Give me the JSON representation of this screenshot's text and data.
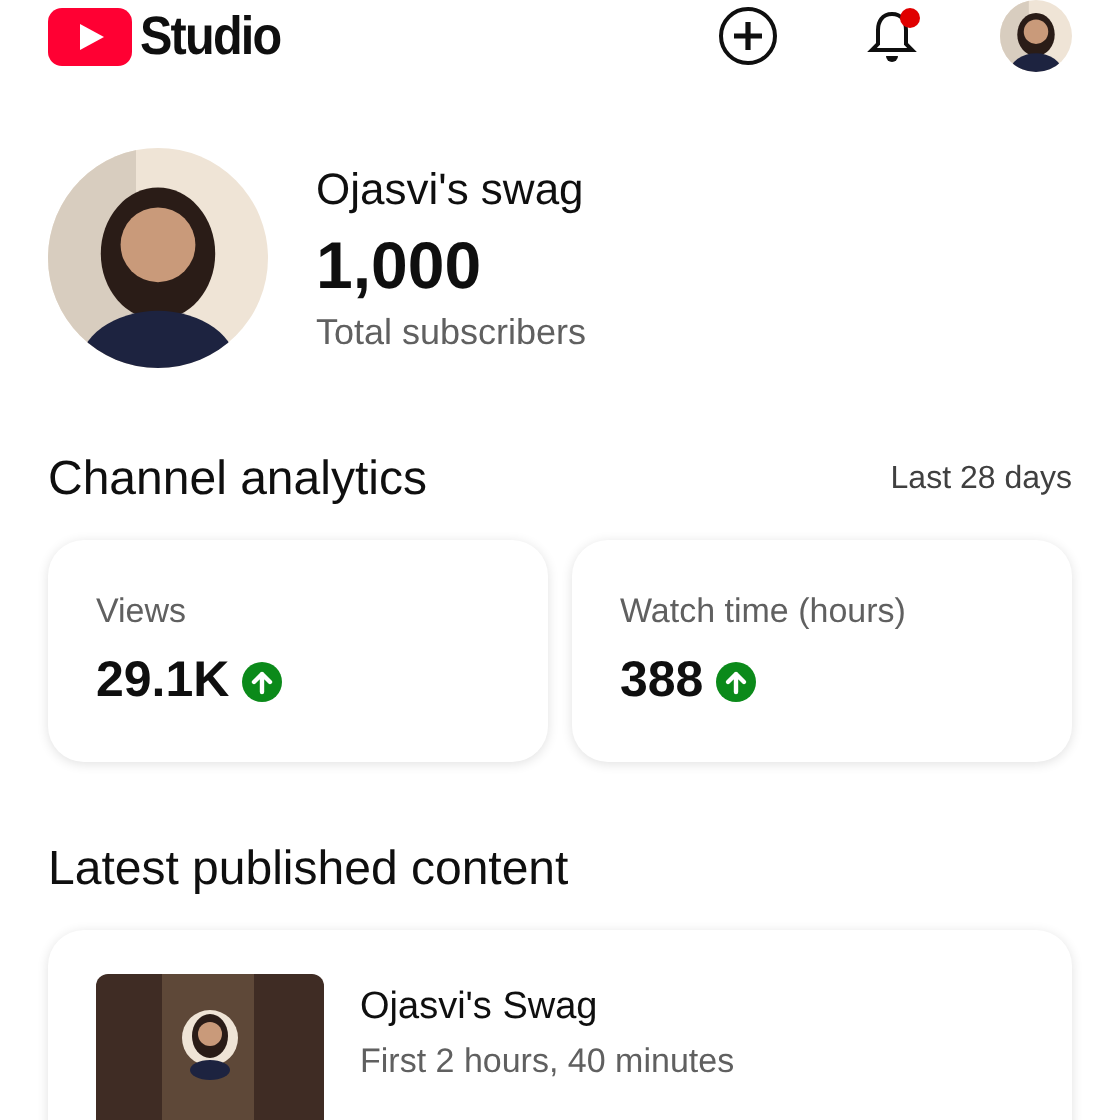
{
  "header": {
    "logo_text": "Studio",
    "notifications": {
      "unread": true
    }
  },
  "channel": {
    "name": "Ojasvi's swag",
    "subscribers": "1,000",
    "subscribers_label": "Total subscribers"
  },
  "analytics": {
    "title": "Channel analytics",
    "period": "Last 28 days",
    "metrics": [
      {
        "label": "Views",
        "value": "29.1K",
        "rising": true
      },
      {
        "label": "Watch time (hours)",
        "value": "388",
        "rising": true
      }
    ]
  },
  "latest": {
    "title": "Latest published content",
    "items": [
      {
        "title": "Ojasvi's Swag",
        "subtitle": "First 2 hours, 40 minutes"
      }
    ]
  }
}
